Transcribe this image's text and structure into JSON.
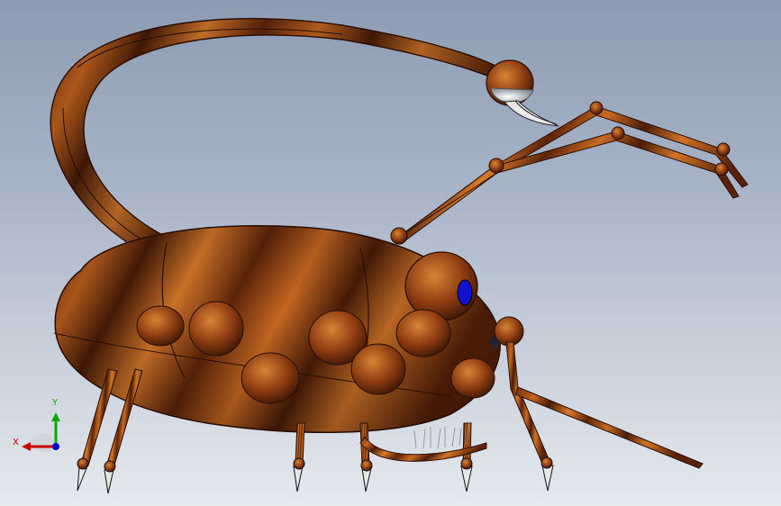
{
  "viewport": {
    "background_top": "#8d9cb3",
    "background_bottom": "#e6e9ee"
  },
  "model": {
    "body_color": "#b5531c",
    "stripe_color": "#3a1606",
    "eye_color": "#1010d0",
    "pincer_color": "#c8c8c8"
  },
  "triad": {
    "x_label": "X",
    "y_label": "Y",
    "x_color": "#cc0000",
    "y_color": "#00aa00",
    "z_color": "#0000cc"
  }
}
